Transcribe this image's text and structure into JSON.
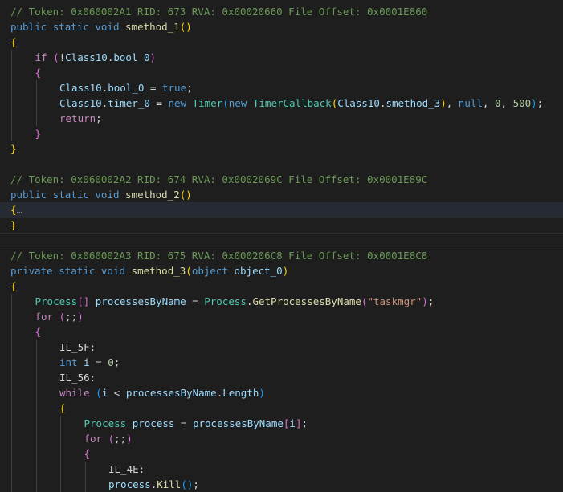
{
  "editor": {
    "language": "csharp",
    "colors": {
      "background": "#1e1e1e",
      "comment": "#6a9955",
      "keyword": "#569cd6",
      "control": "#c586c0",
      "function": "#dcdcaa",
      "type": "#4ec9b0",
      "variable": "#9cdcfe",
      "string": "#ce9178",
      "number": "#b5cea8",
      "bracket_level_1": "#ffd700",
      "bracket_level_2": "#da70d6",
      "bracket_level_3": "#179fff"
    },
    "lines": [
      {
        "indent": 0,
        "tokens": [
          {
            "t": "// Token: 0x060002A1 RID: 673 RVA: 0x00020660 File Offset: 0x0001E860",
            "c": "comment"
          }
        ]
      },
      {
        "indent": 0,
        "tokens": [
          {
            "t": "public",
            "c": "kw"
          },
          {
            "t": " ",
            "c": "plain"
          },
          {
            "t": "static",
            "c": "kw"
          },
          {
            "t": " ",
            "c": "plain"
          },
          {
            "t": "void",
            "c": "kw"
          },
          {
            "t": " ",
            "c": "plain"
          },
          {
            "t": "smethod_1",
            "c": "fn"
          },
          {
            "t": "()",
            "c": "b1"
          }
        ]
      },
      {
        "indent": 0,
        "tokens": [
          {
            "t": "{",
            "c": "b1"
          }
        ]
      },
      {
        "indent": 1,
        "tokens": [
          {
            "t": "if",
            "c": "ctl"
          },
          {
            "t": " ",
            "c": "plain"
          },
          {
            "t": "(",
            "c": "b2"
          },
          {
            "t": "!",
            "c": "plain"
          },
          {
            "t": "Class10",
            "c": "var"
          },
          {
            "t": ".",
            "c": "plain"
          },
          {
            "t": "bool_0",
            "c": "var"
          },
          {
            "t": ")",
            "c": "b2"
          }
        ]
      },
      {
        "indent": 1,
        "tokens": [
          {
            "t": "{",
            "c": "b2"
          }
        ]
      },
      {
        "indent": 2,
        "tokens": [
          {
            "t": "Class10",
            "c": "var"
          },
          {
            "t": ".",
            "c": "plain"
          },
          {
            "t": "bool_0",
            "c": "var"
          },
          {
            "t": " = ",
            "c": "plain"
          },
          {
            "t": "true",
            "c": "kw"
          },
          {
            "t": ";",
            "c": "plain"
          }
        ]
      },
      {
        "indent": 2,
        "tokens": [
          {
            "t": "Class10",
            "c": "var"
          },
          {
            "t": ".",
            "c": "plain"
          },
          {
            "t": "timer_0",
            "c": "var"
          },
          {
            "t": " = ",
            "c": "plain"
          },
          {
            "t": "new",
            "c": "kw"
          },
          {
            "t": " ",
            "c": "plain"
          },
          {
            "t": "Timer",
            "c": "type"
          },
          {
            "t": "(",
            "c": "b3"
          },
          {
            "t": "new",
            "c": "kw"
          },
          {
            "t": " ",
            "c": "plain"
          },
          {
            "t": "TimerCallback",
            "c": "type"
          },
          {
            "t": "(",
            "c": "b1"
          },
          {
            "t": "Class10",
            "c": "var"
          },
          {
            "t": ".",
            "c": "plain"
          },
          {
            "t": "smethod_3",
            "c": "var"
          },
          {
            "t": ")",
            "c": "b1"
          },
          {
            "t": ", ",
            "c": "plain"
          },
          {
            "t": "null",
            "c": "kw"
          },
          {
            "t": ", ",
            "c": "plain"
          },
          {
            "t": "0",
            "c": "num"
          },
          {
            "t": ", ",
            "c": "plain"
          },
          {
            "t": "500",
            "c": "num"
          },
          {
            "t": ")",
            "c": "b3"
          },
          {
            "t": ";",
            "c": "plain"
          }
        ]
      },
      {
        "indent": 2,
        "tokens": [
          {
            "t": "return",
            "c": "ctl"
          },
          {
            "t": ";",
            "c": "plain"
          }
        ]
      },
      {
        "indent": 1,
        "tokens": [
          {
            "t": "}",
            "c": "b2"
          }
        ]
      },
      {
        "indent": 0,
        "tokens": [
          {
            "t": "}",
            "c": "b1"
          }
        ]
      },
      {
        "indent": 0,
        "tokens": []
      },
      {
        "indent": 0,
        "tokens": [
          {
            "t": "// Token: 0x060002A2 RID: 674 RVA: 0x0002069C File Offset: 0x0001E89C",
            "c": "comment"
          }
        ]
      },
      {
        "indent": 0,
        "tokens": [
          {
            "t": "public",
            "c": "kw"
          },
          {
            "t": " ",
            "c": "plain"
          },
          {
            "t": "static",
            "c": "kw"
          },
          {
            "t": " ",
            "c": "plain"
          },
          {
            "t": "void",
            "c": "kw"
          },
          {
            "t": " ",
            "c": "plain"
          },
          {
            "t": "smethod_2",
            "c": "fn"
          },
          {
            "t": "()",
            "c": "b1"
          }
        ]
      },
      {
        "indent": 0,
        "highlight": true,
        "tokens": [
          {
            "t": "{",
            "c": "b1"
          },
          {
            "t": "…",
            "c": "fold"
          }
        ]
      },
      {
        "indent": 0,
        "tokens": [
          {
            "t": "}",
            "c": "b1"
          }
        ]
      },
      {
        "indent": 0,
        "tokens": []
      },
      {
        "indent": 0,
        "tokens": [
          {
            "t": "// Token: 0x060002A3 RID: 675 RVA: 0x000206C8 File Offset: 0x0001E8C8",
            "c": "comment"
          }
        ]
      },
      {
        "indent": 0,
        "tokens": [
          {
            "t": "private",
            "c": "kw"
          },
          {
            "t": " ",
            "c": "plain"
          },
          {
            "t": "static",
            "c": "kw"
          },
          {
            "t": " ",
            "c": "plain"
          },
          {
            "t": "void",
            "c": "kw"
          },
          {
            "t": " ",
            "c": "plain"
          },
          {
            "t": "smethod_3",
            "c": "fn"
          },
          {
            "t": "(",
            "c": "b1"
          },
          {
            "t": "object",
            "c": "kw"
          },
          {
            "t": " ",
            "c": "plain"
          },
          {
            "t": "object_0",
            "c": "var"
          },
          {
            "t": ")",
            "c": "b1"
          }
        ]
      },
      {
        "indent": 0,
        "tokens": [
          {
            "t": "{",
            "c": "b1"
          }
        ]
      },
      {
        "indent": 1,
        "tokens": [
          {
            "t": "Process",
            "c": "type"
          },
          {
            "t": "[]",
            "c": "b2"
          },
          {
            "t": " ",
            "c": "plain"
          },
          {
            "t": "processesByName",
            "c": "var"
          },
          {
            "t": " = ",
            "c": "plain"
          },
          {
            "t": "Process",
            "c": "type"
          },
          {
            "t": ".",
            "c": "plain"
          },
          {
            "t": "GetProcessesByName",
            "c": "fn"
          },
          {
            "t": "(",
            "c": "b2"
          },
          {
            "t": "\"taskmgr\"",
            "c": "str"
          },
          {
            "t": ")",
            "c": "b2"
          },
          {
            "t": ";",
            "c": "plain"
          }
        ]
      },
      {
        "indent": 1,
        "tokens": [
          {
            "t": "for",
            "c": "ctl"
          },
          {
            "t": " ",
            "c": "plain"
          },
          {
            "t": "(",
            "c": "b2"
          },
          {
            "t": ";;",
            "c": "plain"
          },
          {
            "t": ")",
            "c": "b2"
          }
        ]
      },
      {
        "indent": 1,
        "tokens": [
          {
            "t": "{",
            "c": "b2"
          }
        ]
      },
      {
        "indent": 2,
        "tokens": [
          {
            "t": "IL_5F:",
            "c": "plain"
          }
        ]
      },
      {
        "indent": 2,
        "tokens": [
          {
            "t": "int",
            "c": "kw"
          },
          {
            "t": " ",
            "c": "plain"
          },
          {
            "t": "i",
            "c": "var"
          },
          {
            "t": " = ",
            "c": "plain"
          },
          {
            "t": "0",
            "c": "num"
          },
          {
            "t": ";",
            "c": "plain"
          }
        ]
      },
      {
        "indent": 2,
        "tokens": [
          {
            "t": "IL_56:",
            "c": "plain"
          }
        ]
      },
      {
        "indent": 2,
        "tokens": [
          {
            "t": "while",
            "c": "ctl"
          },
          {
            "t": " ",
            "c": "plain"
          },
          {
            "t": "(",
            "c": "b3"
          },
          {
            "t": "i",
            "c": "var"
          },
          {
            "t": " < ",
            "c": "plain"
          },
          {
            "t": "processesByName",
            "c": "var"
          },
          {
            "t": ".",
            "c": "plain"
          },
          {
            "t": "Length",
            "c": "var"
          },
          {
            "t": ")",
            "c": "b3"
          }
        ]
      },
      {
        "indent": 2,
        "tokens": [
          {
            "t": "{",
            "c": "b1"
          }
        ]
      },
      {
        "indent": 3,
        "tokens": [
          {
            "t": "Process",
            "c": "type"
          },
          {
            "t": " ",
            "c": "plain"
          },
          {
            "t": "process",
            "c": "var"
          },
          {
            "t": " = ",
            "c": "plain"
          },
          {
            "t": "processesByName",
            "c": "var"
          },
          {
            "t": "[",
            "c": "b2"
          },
          {
            "t": "i",
            "c": "var"
          },
          {
            "t": "]",
            "c": "b2"
          },
          {
            "t": ";",
            "c": "plain"
          }
        ]
      },
      {
        "indent": 3,
        "tokens": [
          {
            "t": "for",
            "c": "ctl"
          },
          {
            "t": " ",
            "c": "plain"
          },
          {
            "t": "(",
            "c": "b2"
          },
          {
            "t": ";;",
            "c": "plain"
          },
          {
            "t": ")",
            "c": "b2"
          }
        ]
      },
      {
        "indent": 3,
        "tokens": [
          {
            "t": "{",
            "c": "b2"
          }
        ]
      },
      {
        "indent": 4,
        "tokens": [
          {
            "t": "IL_4E:",
            "c": "plain"
          }
        ]
      },
      {
        "indent": 4,
        "tokens": [
          {
            "t": "process",
            "c": "var"
          },
          {
            "t": ".",
            "c": "plain"
          },
          {
            "t": "Kill",
            "c": "fn"
          },
          {
            "t": "()",
            "c": "b3"
          },
          {
            "t": ";",
            "c": "plain"
          }
        ]
      }
    ]
  }
}
